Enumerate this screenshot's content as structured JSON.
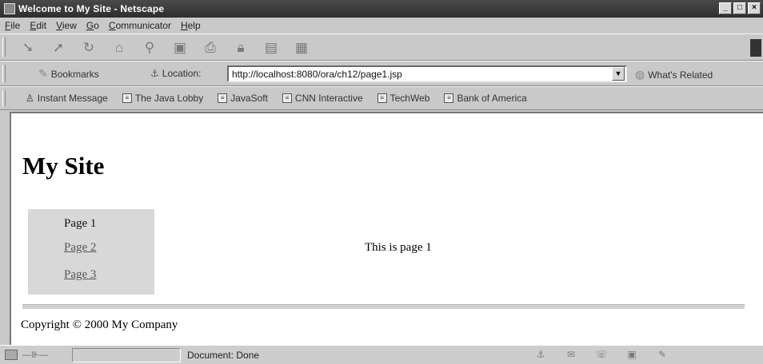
{
  "window": {
    "title": "Welcome to My Site - Netscape"
  },
  "titlebar_buttons": {
    "minimize": "_",
    "maximize": "□",
    "close": "×"
  },
  "menu": [
    "File",
    "Edit",
    "View",
    "Go",
    "Communicator",
    "Help"
  ],
  "nav_toolbar": {
    "icons": [
      "back-icon",
      "forward-icon",
      "reload-icon",
      "home-icon",
      "search-icon",
      "netscape-icon",
      "print-icon",
      "security-icon",
      "shop-icon",
      "stop-icon"
    ]
  },
  "location_toolbar": {
    "bookmarks_label": "Bookmarks",
    "location_label": "Location:",
    "url": "http://localhost:8080/ora/ch12/page1.jsp",
    "whats_related_label": "What's Related"
  },
  "personal_toolbar": {
    "items": [
      "Instant Message",
      "The Java Lobby",
      "JavaSoft",
      "CNN Interactive",
      "TechWeb",
      "Bank of America"
    ]
  },
  "page": {
    "site_title": "My Site",
    "nav": {
      "current": "Page 1",
      "links": [
        "Page 2",
        "Page 3"
      ]
    },
    "main_text": "This is page 1",
    "copyright": "Copyright © 2000 My Company"
  },
  "statusbar": {
    "status_text": "Document: Done"
  }
}
